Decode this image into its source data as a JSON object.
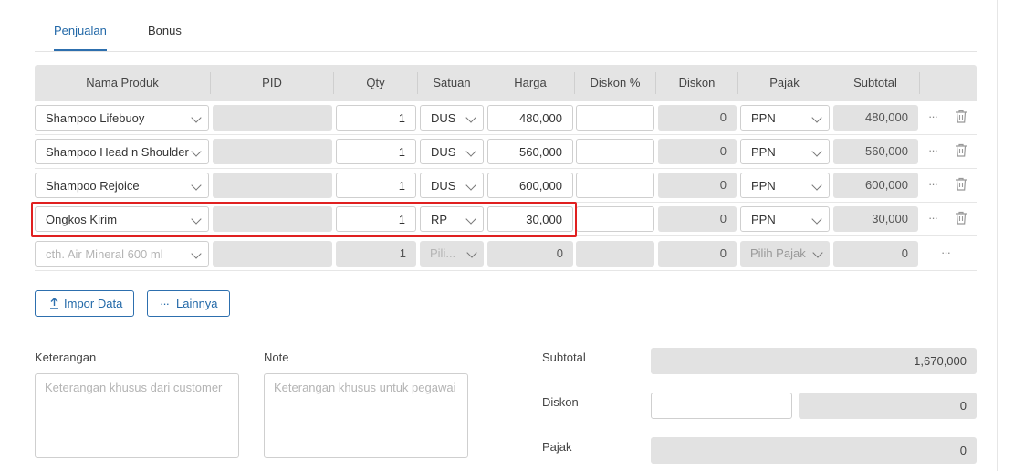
{
  "tabs": [
    {
      "label": "Penjualan",
      "active": true
    },
    {
      "label": "Bonus",
      "active": false
    }
  ],
  "table": {
    "headers": [
      "Nama Produk",
      "PID",
      "Qty",
      "Satuan",
      "Harga",
      "Diskon %",
      "Diskon",
      "Pajak",
      "Subtotal"
    ],
    "rows": [
      {
        "product": "Shampoo Lifebuoy",
        "pid": "",
        "qty": "1",
        "unit": "DUS",
        "price": "480,000",
        "disc_pct": "",
        "disc": "0",
        "tax": "PPN",
        "subtotal": "480,000"
      },
      {
        "product": "Shampoo Head n Shoulder",
        "pid": "",
        "qty": "1",
        "unit": "DUS",
        "price": "560,000",
        "disc_pct": "",
        "disc": "0",
        "tax": "PPN",
        "subtotal": "560,000"
      },
      {
        "product": "Shampoo Rejoice",
        "pid": "",
        "qty": "1",
        "unit": "DUS",
        "price": "600,000",
        "disc_pct": "",
        "disc": "0",
        "tax": "PPN",
        "subtotal": "600,000"
      },
      {
        "product": "Ongkos Kirim",
        "pid": "",
        "qty": "1",
        "unit": "RP",
        "price": "30,000",
        "disc_pct": "",
        "disc": "0",
        "tax": "PPN",
        "subtotal": "30,000"
      }
    ],
    "new_row": {
      "product_placeholder": "cth. Air Mineral 600 ml",
      "qty": "1",
      "unit_placeholder": "Pili...",
      "price": "0",
      "disc": "0",
      "tax_placeholder": "Pilih Pajak",
      "subtotal": "0"
    },
    "more_icon": "···"
  },
  "buttons": {
    "import": {
      "label": "Impor Data",
      "icon": "upload-icon"
    },
    "more": {
      "label": "Lainnya",
      "icon": "more-horizontal-icon"
    }
  },
  "notes": {
    "keterangan_label": "Keterangan",
    "keterangan_placeholder": "Keterangan khusus dari customer",
    "note_label": "Note",
    "note_placeholder": "Keterangan khusus untuk pegawai"
  },
  "summary": {
    "subtotal_label": "Subtotal",
    "subtotal_value": "1,670,000",
    "discount_label": "Diskon",
    "discount_input": "",
    "discount_value": "0",
    "tax_label": "Pajak",
    "tax_value": "0"
  },
  "colors": {
    "accent": "#2d6fae",
    "highlight": "#e02020"
  }
}
